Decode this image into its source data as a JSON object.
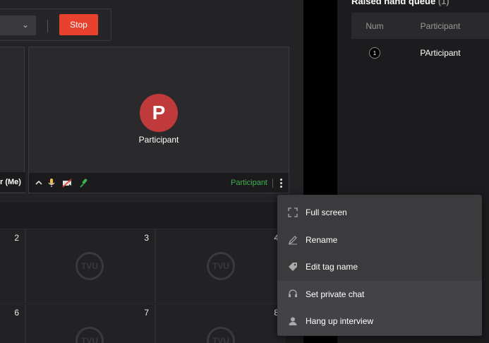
{
  "toolbar": {
    "stop_label": "Stop"
  },
  "tiles": {
    "me_label": "r (Me)",
    "participant": {
      "initial": "P",
      "name": "Participant",
      "tag": "Participant"
    }
  },
  "grid": {
    "cells": [
      "2",
      "3",
      "4",
      "6",
      "7",
      "8"
    ],
    "watermark": "TVU"
  },
  "queue": {
    "title": "Raised hand queue",
    "count": "(1)",
    "headers": {
      "num": "Num",
      "participant": "Participant"
    },
    "rows": [
      {
        "num": "1",
        "name": "PArticipant"
      }
    ]
  },
  "context_menu": {
    "items": [
      {
        "label": "Full screen",
        "icon": "fullscreen-icon"
      },
      {
        "label": "Rename",
        "icon": "pencil-icon"
      },
      {
        "label": "Edit tag name",
        "icon": "tag-icon"
      },
      {
        "label": "Set private chat",
        "icon": "headset-icon"
      },
      {
        "label": "Hang up interview",
        "icon": "user-icon"
      }
    ]
  },
  "colors": {
    "stop": "#e8412e",
    "avatar": "#c0393b",
    "tag": "#3fb24f",
    "mic_active": "#3fb24f"
  }
}
